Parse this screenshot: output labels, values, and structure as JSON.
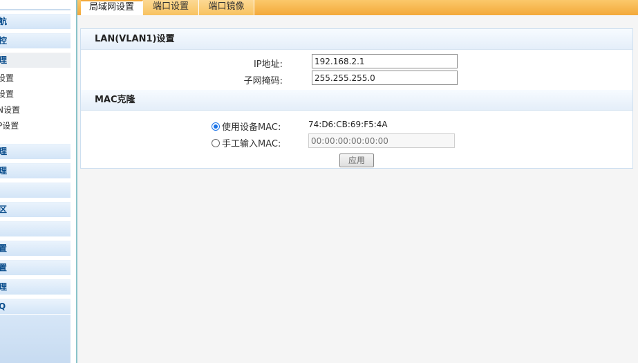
{
  "sidebar": {
    "items": [
      {
        "label": "航"
      },
      {
        "label": "控"
      },
      {
        "label": "理"
      },
      {
        "label": "理"
      },
      {
        "label": "理"
      },
      {
        "label": ""
      },
      {
        "label": "区"
      },
      {
        "label": ""
      },
      {
        "label": "置"
      },
      {
        "label": "置"
      },
      {
        "label": "理"
      },
      {
        "label": "Q"
      }
    ],
    "sub_items": [
      {
        "label": "设置"
      },
      {
        "label": "设置"
      },
      {
        "label": "N设置"
      },
      {
        "label": "P设置"
      }
    ]
  },
  "tabs": [
    {
      "label": "局域网设置",
      "active": true
    },
    {
      "label": "端口设置",
      "active": false
    },
    {
      "label": "端口镜像",
      "active": false
    }
  ],
  "lan": {
    "title": "LAN(VLAN1)设置",
    "ip_label": "IP地址:",
    "ip_value": "192.168.2.1",
    "mask_label": "子网掩码:",
    "mask_value": "255.255.255.0"
  },
  "mac": {
    "title": "MAC克隆",
    "use_device_label": "使用设备MAC:",
    "device_mac": "74:D6:CB:69:F5:4A",
    "manual_label": "手工输入MAC:",
    "manual_placeholder": "00:00:00:00:00:00",
    "selected": "use_device"
  },
  "apply_label": "应用",
  "colors": {
    "accent_orange": "#f3a93a",
    "nav_blue": "#0a4d8c",
    "radio_blue": "#1a73e8"
  }
}
